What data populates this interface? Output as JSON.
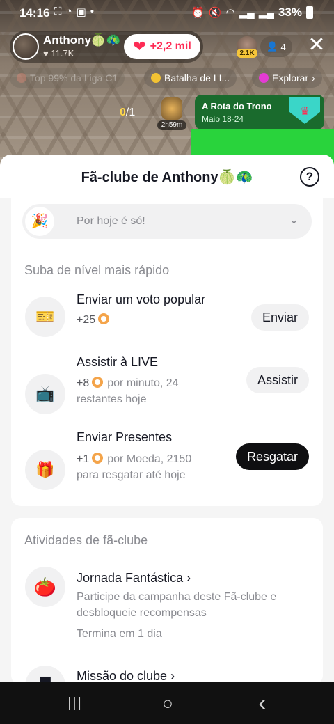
{
  "status_bar": {
    "time": "14:16",
    "left_icons": [
      "screenshot-icon",
      "whatsapp-icon",
      "nfc-icon",
      "dot-icon"
    ],
    "right_icons": [
      "alarm-icon",
      "mute-icon",
      "wifi-icon",
      "signal-icon",
      "signal-icon",
      "battery-icon"
    ],
    "battery": "33%"
  },
  "live": {
    "host_name": "Anthony🍈🦚",
    "host_likes": "♥ 11.7K",
    "heart_label": "+2,2 mil",
    "viewer_badge": "2.1K",
    "viewer_count": "4",
    "chips": [
      {
        "label": "Top 99% da Liga C1",
        "faded": true
      },
      {
        "label": "Batalha de LI...",
        "faded": false
      },
      {
        "label": "Explorar",
        "faded": false
      }
    ],
    "ratio_current": "0",
    "ratio_total": "/1",
    "mini_timer": "2h59m",
    "event": {
      "title": "A Rota do Trono",
      "date": "Maio 18-24"
    }
  },
  "sheet": {
    "title": "Fã-clube de Anthony🍈🦚",
    "help_symbol": "?",
    "today_text": "Por hoje é só!",
    "level_up_title": "Suba de nível mais rápido",
    "tasks": [
      {
        "title": "Enviar um voto popular",
        "points": "+25",
        "detail": "",
        "detail2": "",
        "button": "Enviar",
        "icon": "ticket-icon"
      },
      {
        "title": "Assistir à LIVE",
        "points": "+8",
        "detail": "por minuto, 24",
        "detail2": "restantes hoje",
        "button": "Assistir",
        "icon": "tv-icon"
      },
      {
        "title": "Enviar Presentes",
        "points": "+1",
        "detail": "por Moeda, 2150",
        "detail2": "para resgatar até hoje",
        "button": "Resgatar",
        "icon": "gift-icon"
      }
    ],
    "activities_title": "Atividades de fã-clube",
    "activities": [
      {
        "title": "Jornada Fantástica",
        "desc": "Participe da campanha deste Fã-clube e desbloqueie recompensas",
        "ends": "Termina em 1 dia",
        "icon": "journey-icon"
      },
      {
        "title": "Missão do clube",
        "desc": "",
        "ends": "",
        "icon": "mission-icon"
      }
    ]
  },
  "nav": {
    "recent": "|||",
    "home": "○",
    "back": "‹"
  },
  "colors": {
    "accent": "#fe2c55",
    "coin": "#f4a44a",
    "event_green": "#1a6b2d"
  }
}
